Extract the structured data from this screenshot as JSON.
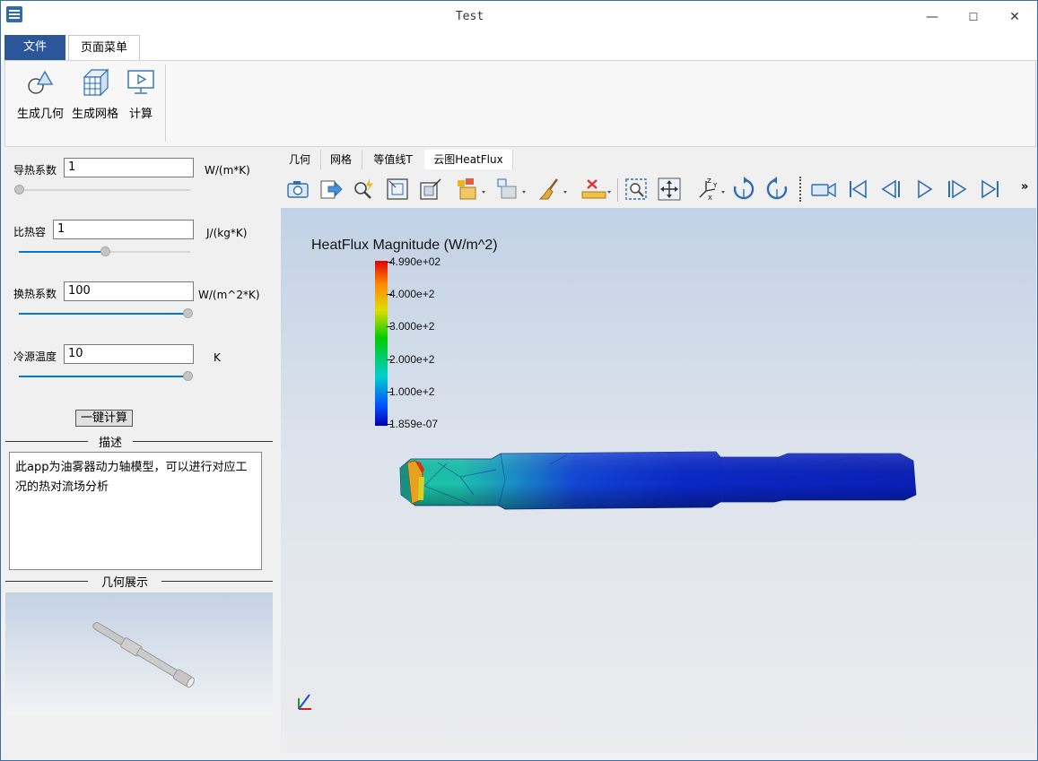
{
  "window": {
    "title": "Test",
    "minimize": "—",
    "maximize": "☐",
    "close": "✕"
  },
  "menu": {
    "file": "文件",
    "page_menu": "页面菜单"
  },
  "ribbon": {
    "gen_geometry": "生成几何",
    "gen_mesh": "生成网格",
    "compute": "计算"
  },
  "params": [
    {
      "label": "导热系数",
      "value": "1",
      "unit": "W/(m*K)",
      "slider": 0.0
    },
    {
      "label": "比热容",
      "value": "1",
      "unit": "J/(kg*K)",
      "slider": 0.5
    },
    {
      "label": "换热系数",
      "value": "100",
      "unit": "W/(m^2*K)",
      "slider": 1.0
    },
    {
      "label": "冷源温度",
      "value": "10",
      "unit": "K",
      "slider": 1.0
    }
  ],
  "calc_button": "一键计算",
  "description": {
    "title": "描述",
    "text": "此app为油雾器动力轴模型，可以进行对应工况的热对流场分析"
  },
  "geometry_section": {
    "title": "几何展示"
  },
  "view_tabs": [
    "几何",
    "网格",
    "等值线T",
    "云图HeatFlux"
  ],
  "toolbar_overflow": "»",
  "heatflux": {
    "title": "HeatFlux Magnitude (W/m^2)",
    "ticks": [
      "4.990e+02",
      "4.000e+2",
      "3.000e+2",
      "2.000e+2",
      "1.000e+2",
      "1.859e-07"
    ]
  },
  "colors": {
    "accent": "#2b579a",
    "slider_fill": "#0078d7"
  }
}
